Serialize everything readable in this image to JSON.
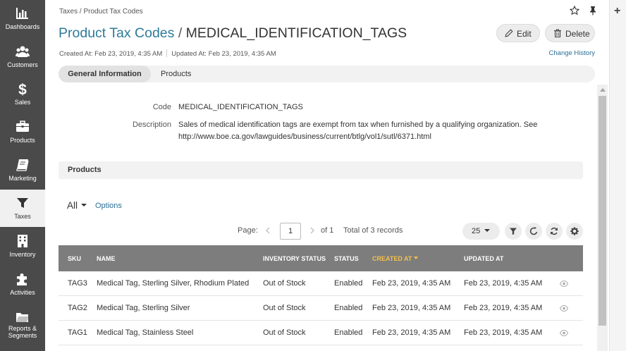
{
  "nav": {
    "items": [
      {
        "label": "Dashboards",
        "icon": "bar-chart-icon"
      },
      {
        "label": "Customers",
        "icon": "users-icon"
      },
      {
        "label": "Sales",
        "icon": "dollar-icon"
      },
      {
        "label": "Products",
        "icon": "briefcase-icon"
      },
      {
        "label": "Marketing",
        "icon": "book-icon"
      },
      {
        "label": "Taxes",
        "icon": "funnel-icon"
      },
      {
        "label": "Inventory",
        "icon": "building-icon"
      },
      {
        "label": "Activities",
        "icon": "puzzle-icon"
      },
      {
        "label": "Reports &",
        "label2": "Segments",
        "icon": "folder-icon"
      }
    ],
    "active": "Taxes"
  },
  "breadcrumb": "Taxes / Product Tax Codes",
  "title": {
    "entity": "Product Tax Codes",
    "separator": "/",
    "code": "MEDICAL_IDENTIFICATION_TAGS"
  },
  "actions": {
    "edit": "Edit",
    "delete": "Delete"
  },
  "meta": {
    "created": "Created At: Feb 23, 2019, 4:35 AM",
    "updated": "Updated At: Feb 23, 2019, 4:35 AM",
    "change_history": "Change History"
  },
  "tabs": [
    "General Information",
    "Products"
  ],
  "fields": {
    "code_label": "Code",
    "code_value": "MEDICAL_IDENTIFICATION_TAGS",
    "description_label": "Description",
    "description_line1": "Sales of medical identification tags are exempt from tax when furnished by a qualifying organization. See",
    "description_line2": "http://www.boe.ca.gov/lawguides/business/current/btlg/vol1/sutl/6371.html"
  },
  "products_section": "Products",
  "grid": {
    "view": "All",
    "options": "Options",
    "page_label": "Page:",
    "page": "1",
    "of": "of 1",
    "total": "Total of 3 records",
    "per_page": "25",
    "columns": [
      "SKU",
      "NAME",
      "INVENTORY STATUS",
      "STATUS",
      "CREATED AT",
      "UPDATED AT"
    ],
    "sorted_column": "CREATED AT",
    "rows": [
      {
        "sku": "TAG3",
        "name": "Medical Tag, Sterling Silver, Rhodium Plated",
        "inventory": "Out of Stock",
        "status": "Enabled",
        "created": "Feb 23, 2019, 4:35 AM",
        "updated": "Feb 23, 2019, 4:35 AM"
      },
      {
        "sku": "TAG2",
        "name": "Medical Tag, Sterling Silver",
        "inventory": "Out of Stock",
        "status": "Enabled",
        "created": "Feb 23, 2019, 4:35 AM",
        "updated": "Feb 23, 2019, 4:35 AM"
      },
      {
        "sku": "TAG1",
        "name": "Medical Tag, Stainless Steel",
        "inventory": "Out of Stock",
        "status": "Enabled",
        "created": "Feb 23, 2019, 4:35 AM",
        "updated": "Feb 23, 2019, 4:35 AM"
      }
    ]
  },
  "colors": {
    "nav_bg": "#4a4a4a",
    "link": "#2e7a9a",
    "header_bg": "#7d7d7d",
    "sorted": "#f4c04e"
  }
}
